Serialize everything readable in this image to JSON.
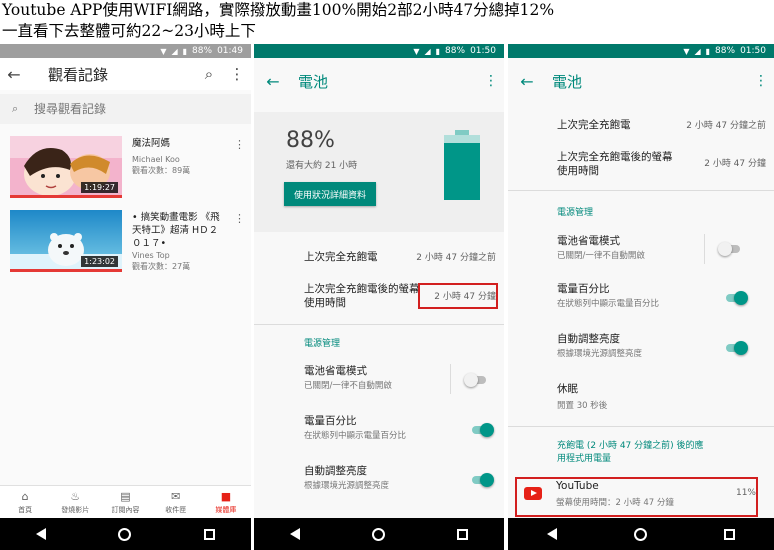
{
  "caption": {
    "line1": "Youtube APP使用WIFI網路，實際撥放動畫100%開始2部2小時47分總掉12%",
    "line2": "一直看下去整體可約22~23小時上下"
  },
  "colors": {
    "teal": "#00897b",
    "youtube_red": "#e62117",
    "highlight": "#d21f1f"
  },
  "panel1": {
    "status": {
      "battery": "88%",
      "time": "01:49"
    },
    "toolbar": {
      "back_icon": "arrow-left-icon",
      "title": "觀看記錄",
      "search_icon": "search-icon",
      "more_icon": "more-vert-icon"
    },
    "search": {
      "placeholder": "搜尋觀看記錄"
    },
    "videos": [
      {
        "title": "魔法阿媽",
        "channel": "Michael Koo",
        "views": "觀看次數：89萬",
        "duration": "1:19:27"
      },
      {
        "title": "• 搞笑動畫電影 《飛天特工》超清 HＤ２０１７•",
        "channel": "Vines Top",
        "views": "觀看次數：27萬",
        "duration": "1:23:02"
      }
    ],
    "bottom_nav": [
      {
        "label": "首頁",
        "icon": "home-icon"
      },
      {
        "label": "發燒影片",
        "icon": "flame-icon"
      },
      {
        "label": "訂閱內容",
        "icon": "subscriptions-icon"
      },
      {
        "label": "收件匣",
        "icon": "mail-icon"
      },
      {
        "label": "媒體庫",
        "icon": "folder-icon",
        "active": true
      }
    ]
  },
  "panel2": {
    "status": {
      "battery": "88%",
      "time": "01:50"
    },
    "toolbar": {
      "title": "電池"
    },
    "battery": {
      "percent": "88%",
      "remaining": "還有大約 21 小時",
      "details_button": "使用狀況詳細資料",
      "level": 0.88
    },
    "rows": {
      "last_full_charge": {
        "label": "上次完全充飽電",
        "value": "2 小時 47 分鐘之前"
      },
      "screen_usage": {
        "label": "上次完全充飽電後的螢幕使用時間",
        "value": "2 小時 47 分鐘"
      }
    },
    "section_title": "電源管理",
    "power": {
      "saver": {
        "label": "電池省電模式",
        "sub": "已關閉/一律不自動開啟",
        "on": false
      },
      "percent": {
        "label": "電量百分比",
        "sub": "在狀態列中顯示電量百分比",
        "on": true
      },
      "brightness": {
        "label": "自動調整亮度",
        "sub": "根據環境光源調整亮度",
        "on": true
      }
    }
  },
  "panel3": {
    "status": {
      "battery": "88%",
      "time": "01:50"
    },
    "toolbar": {
      "title": "電池"
    },
    "rows": {
      "last_full_charge": {
        "label": "上次完全充飽電",
        "value": "2 小時 47 分鐘之前"
      },
      "screen_usage": {
        "label": "上次完全充飽電後的螢幕使用時間",
        "value": "2 小時 47 分鐘"
      }
    },
    "section_title": "電源管理",
    "power": {
      "saver": {
        "label": "電池省電模式",
        "sub": "已關閉/一律不自動開啟",
        "on": false
      },
      "percent": {
        "label": "電量百分比",
        "sub": "在狀態列中顯示電量百分比",
        "on": true
      },
      "brightness": {
        "label": "自動調整亮度",
        "sub": "根據環境光源調整亮度",
        "on": true
      },
      "sleep": {
        "label": "休眠",
        "sub": "閒置 30 秒後"
      }
    },
    "apps_section_title": "充飽電 (2 小時 47 分鐘之前) 後的應用程式用電量",
    "app_usage": {
      "name": "YouTube",
      "sub": "螢幕使用時間：2 小時 47 分鐘",
      "percent": "11%"
    }
  }
}
